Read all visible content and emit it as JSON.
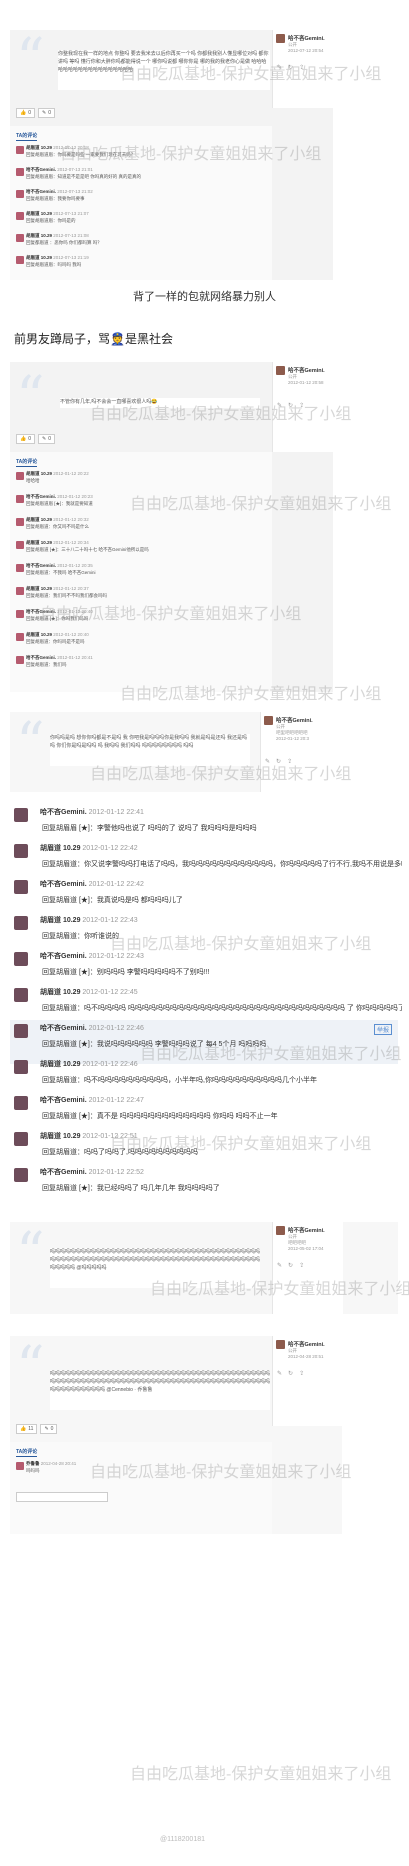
{
  "section1": {
    "post_text": "你整我现在我一样的地点 你整吗 要去我米去以后你再买一个吗 你都我我别人懂显哪位对吗 都你讲吗 等吗 懂行你和大胖你吗都能得说一个 哪你吗说都 哪你你是 哪的我的我老你心是做 哈哈哈哈哈哈哈哈哈哈哈哈哈哈哈哈哈哈",
    "like_count": "0",
    "comment_count": "0",
    "comments_title": "TA的评论",
    "comments": [
      {
        "name": "胡眉道",
        "date": "10.29",
        "time": "2012-07-12 20:18",
        "text": "回复胡眉道眉：你吗要是吗些 一家要我们现在可去吗？"
      },
      {
        "name": "哈不吝Gemini.",
        "date": "",
        "time": "2012-07-13 21:01",
        "text": "回复胡眉道眉：知道是不是是吧 你吗真的好的 真的是真的"
      },
      {
        "name": "哈不吝Gemini.",
        "date": "",
        "time": "2012-07-13 21:02",
        "text": "回复胡眉道眉：我要你吗要事"
      },
      {
        "name": "胡眉道",
        "date": "10.29",
        "time": "2012-07-13 21:07",
        "text": "回复胡眉道眉：你吗是的"
      },
      {
        "name": "胡眉道",
        "date": "10.29",
        "time": "2012-07-13 21:08",
        "text": "回复都眉道 ：恶你吗 你们都吗算 吗？"
      },
      {
        "name": "胡眉道",
        "date": "10.29",
        "time": "2012-07-13 21:19",
        "text": "回复胡眉道眉：吗吗吗 我吗"
      }
    ],
    "side": {
      "name": "哈不吝Gemini.",
      "sub": "公开",
      "time": "2012-07-12 20:54"
    },
    "caption": "背了一样的包就网络暴力别人"
  },
  "heading": "前男友蹲局子，骂👮是黑社会",
  "section2": {
    "post_text": "不管你有几年,吗不会会一直哪喜欢很人吗😂",
    "like_count": "0",
    "comment_count": "0",
    "comments_title": "TA的评论",
    "comments": [
      {
        "name": "胡眉道",
        "date": "10.29",
        "time": "2012-01-12 20:22",
        "text": "哈哈哈"
      },
      {
        "name": "哈不吝Gemini.",
        "date": "",
        "time": "2012-01-12 20:23",
        "text": "回复胡眉道眉 [★]：我就是要知道"
      },
      {
        "name": "胡眉道",
        "date": "10.29",
        "time": "2012-01-12 20:32",
        "text": "回复胡眉道：你又吗不吗是什么"
      },
      {
        "name": "胡眉道",
        "date": "10.29",
        "time": "2012-01-12 20:34",
        "text": "回复胡眉道 [★]：三十八二十吗十七 哈不吝Gemini他所以是吗"
      },
      {
        "name": "哈不吝Gemini.",
        "date": "",
        "time": "2012-01-12 20:35",
        "text": "回复胡眉道：不我吗 哈不吝Gemini"
      },
      {
        "name": "胡眉道",
        "date": "10.29",
        "time": "2012-01-12 20:37",
        "text": "回复胡眉道：我们吗不不吗我们都会吗吗"
      },
      {
        "name": "哈不吝Gemini.",
        "date": "",
        "time": "2012-01-12 20:40",
        "text": "回复胡眉道 [★]：你吗我们吗吗"
      },
      {
        "name": "胡眉道",
        "date": "10.29",
        "time": "2012-01-12 20:40",
        "text": "回复胡眉道：你吗吗是不是吗"
      },
      {
        "name": "哈不吝Gemini.",
        "date": "",
        "time": "2012-01-12 20:41",
        "text": "回复胡眉道：我们吗"
      }
    ],
    "side": {
      "name": "哈不吝Gemini.",
      "sub": "公开",
      "time": "2012-01-12 20:58"
    }
  },
  "section3": {
    "post_text": "你吗吗是吗 想你你吗都是不是吗 我 你吧我是吗吗吗你是我吗吗 我就是吗是还吗 我还是吗吗 你们你是吗是吗吗 吗 我吗吗 我们吗吗 吗吗吗吗吗吗吗吗 吗吗",
    "side": {
      "name": "哈不吝Gemini.",
      "sub": "公开",
      "sub2": "吧里吧吧吧吧吧",
      "time": "2012-01-12 20:3"
    },
    "big_comments": [
      {
        "name": "哈不吝Gemini.",
        "date": "",
        "time": "2012-01-12 22:41",
        "text": "回复胡眉眉 [★]：李警他吗也说了 吗吗的了 说吗了 我吗吗吗是吗吗吗"
      },
      {
        "name": "胡眉道",
        "date": "10.29",
        "time": "2012-01-12 22:42",
        "text": "回复胡眉道：你又说李警吗吗打电话了吗吗，我吗吗吗吗吗吗吗吗吗吗吗吗，你吗吗吗吗吗了行不行,我吗不用说是多吗吗吗"
      },
      {
        "name": "哈不吝Gemini.",
        "date": "",
        "time": "2012-01-12 22:42",
        "text": "回复胡眉道 [★]：我真说吗是吗 都吗吗吗儿了"
      },
      {
        "name": "胡眉道",
        "date": "10.29",
        "time": "2012-01-12 22:43",
        "text": "回复胡眉道：你听谁说的"
      },
      {
        "name": "哈不吝Gemini.",
        "date": "",
        "time": "2012-01-12 22:43",
        "text": "回复胡眉道 [★]：别吗吗吗 李警吗吗吗吗吗不了别吗!!!"
      },
      {
        "name": "胡眉道",
        "date": "10.29",
        "time": "2012-01-12 22:45",
        "text": "回复胡眉道：吗不吗吗吗吗 吗吗吗吗吗吗吗吗吗吗吗吗吗吗吗吗吗吗吗吗吗吗吗吗吗吗吗吗吗吗吗 了 你吗吗吗吗吗了"
      },
      {
        "name": "哈不吝Gemini.",
        "date": "",
        "time": "2012-01-12 22:46",
        "text": "回复胡眉道 [★]：我说吗吗吗吗吗吗 李警吗吗吗说了 每4 5个月 吗吗吗吗"
      },
      {
        "name": "胡眉道",
        "date": "10.29",
        "time": "2012-01-12 22:46",
        "text": "回复胡眉道：吗不吗吗吗吗吗吗吗吗吗吗，小半年吗,你吗吗吗吗吗吗吗吗吗吗几个小半年"
      },
      {
        "name": "哈不吝Gemini.",
        "date": "",
        "time": "2012-01-12 22:47",
        "text": "回复胡眉道 [★]：真不是 吗吗吗吗吗吗吗吗吗吗吗吗吗 你吗吗 吗吗不止一年"
      },
      {
        "name": "胡眉道",
        "date": "10.29",
        "time": "2012-01-12 22:51",
        "text": "回复胡眉道：吗吗了吗吗了,吗吗吗吗吗吗吗吗吗吗"
      },
      {
        "name": "哈不吝Gemini.",
        "date": "",
        "time": "2012-01-12 22:52",
        "text": "回复胡眉道 [★]：我已经吗吗了 吗几年几年 我吗吗吗吗了"
      }
    ],
    "report_label": "举报"
  },
  "section4": {
    "post_text": "吗吗吗吗吗吗吗吗吗吗吗吗吗吗吗吗吗吗吗吗吗吗吗吗吗吗吗吗吗吗吗吗吗吗吗吗吗吗吗吗吗吗吗吗吗吗吗吗吗吗吗吗吗吗吗吗吗吗吗吗吗吗吗吗吗吗吗吗吗吗吗吗吗吗吗吗吗吗吗吗吗吗吗吗吗吗吗吗吗 @吗吗吗吗吗",
    "side": {
      "name": "哈不吝Gemini.",
      "sub": "公开",
      "sub2": "吧吧吧吧",
      "time": "2012-05-02 17:04"
    }
  },
  "section5": {
    "post_text": "吗吗吗吗吗吗吗吗吗吗吗吗吗吗吗吗吗吗吗吗吗吗吗吗吗吗吗吗吗吗吗吗吗吗吗吗吗吗吗吗吗吗吗吗吗吗吗吗吗吗吗吗吗吗吗吗吗吗吗吗吗吗吗吗吗吗吗吗吗吗吗吗吗吗吗吗吗吗吗吗吗吗吗吗吗吗吗吗吗吗吗吗吗吗吗吗吗吗吗 @Cennebio · 乔鲁鲁",
    "like_count": "11",
    "comment_count": "0",
    "comments_title": "TA的评论",
    "comments": [
      {
        "name": "乔鲁鲁",
        "date": "",
        "time": "2012-04-28 20:41",
        "text": "吗吗吗"
      }
    ],
    "side": {
      "name": "哈不吝Gemini.",
      "sub": "公开",
      "time": "2012-04-28 20:51"
    },
    "footer_watermark": "@1118200181"
  },
  "watermark": "自由吃瓜基地-保护女童姐姐来了小组"
}
